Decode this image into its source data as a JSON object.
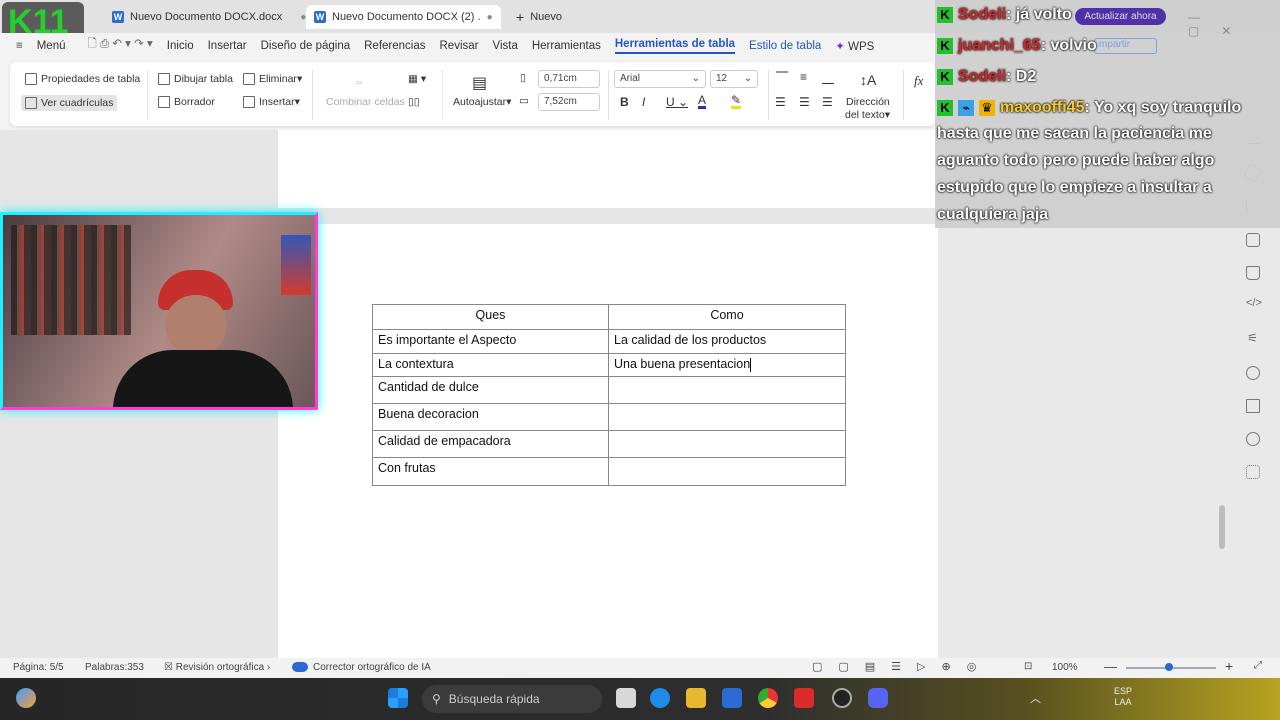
{
  "tabs": [
    {
      "label": "Nuevo Documento DOCX.docx"
    },
    {
      "label": "Nuevo Documento DOCX (2) ."
    },
    {
      "label": "Nuevo"
    }
  ],
  "menu": {
    "menu_label": "Menú",
    "items": [
      "Inicio",
      "Insertar",
      "Diseño de página",
      "Referencias",
      "Revisar",
      "Vista",
      "Herramientas"
    ],
    "active": "Herramientas de tabla",
    "style": "Estilo de tabla",
    "wps": "WPS"
  },
  "ribbon": {
    "properties": "Propiedades de tabla",
    "gridlines": "Ver cuadrículas",
    "draw": "Dibujar tabla",
    "eraser": "Borrador",
    "delete": "Eliminar",
    "insert": "Insertar",
    "merge": "Combinar celdas",
    "autofit": "Autoajustar",
    "height": "0,71cm",
    "width": "7,52cm",
    "font": "Arial",
    "size": "12",
    "direction1": "Dirección",
    "direction2": "del texto",
    "fx": "fx"
  },
  "table": {
    "headers": [
      "Ques",
      "Como"
    ],
    "rows": [
      [
        "Es importante el Aspecto",
        "La calidad de los productos"
      ],
      [
        "La contextura",
        "Una buena presentacion"
      ],
      [
        "Cantidad de dulce",
        ""
      ],
      [
        "Buena decoracion",
        ""
      ],
      [
        "Calidad de empacadora",
        ""
      ],
      [
        "Con frutas",
        ""
      ]
    ]
  },
  "chat": [
    {
      "user": "Sodeli",
      "msg": ": já volto"
    },
    {
      "user": "juanchi_65",
      "msg": ": volvio"
    },
    {
      "user": "Sodeli",
      "msg": ": D2"
    },
    {
      "user": "maxooffi45",
      "msg": ": Yo xq soy tranquilo"
    },
    {
      "cont": "hasta que me sacan la paciencia me"
    },
    {
      "cont": "aguanto todo pero puede haber algo"
    },
    {
      "cont": "estupido que lo empieze a insultar a"
    },
    {
      "cont": "cualquiera jaja"
    }
  ],
  "overlay": {
    "update": "Actualizar ahora",
    "share": "mpartir",
    "badge": "11"
  },
  "status": {
    "page": "Página: 5/5",
    "words": "Palabras:353",
    "spell": "Revisión ortográfica",
    "ai": "Corrector ortográfico de IA",
    "zoom": "100%"
  },
  "taskbar": {
    "search": "Búsqueda rápida",
    "lang1": "ESP",
    "lang2": "LAA"
  },
  "colors": {
    "accent": "#2257c9",
    "chat_bg": "#cdcdcd",
    "webcam_border": "#1ef0ff"
  }
}
